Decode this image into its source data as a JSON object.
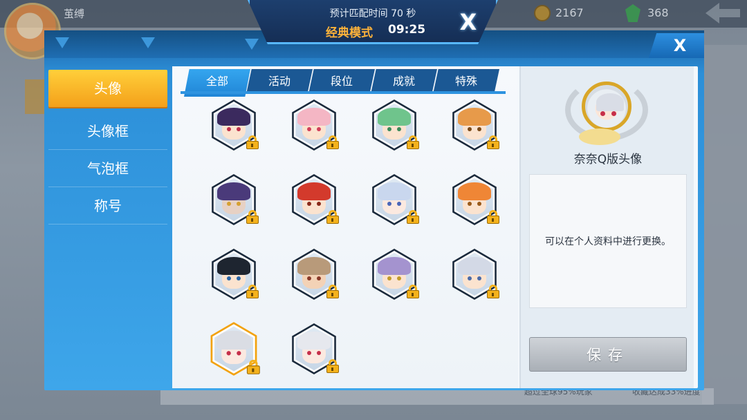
{
  "background": {
    "username": "茧缚",
    "coins": "2167",
    "gems": "368",
    "bottom_text_left": "超过全球95%玩家",
    "bottom_text_right": "收藏达成33%进度"
  },
  "match_banner": {
    "estimate_text": "预计匹配时间 70 秒",
    "mode": "经典模式",
    "clock": "09:25",
    "cancel_label": "X"
  },
  "dialog": {
    "close_label": "X",
    "sidenav": [
      {
        "label": "头像",
        "active": true
      },
      {
        "label": "头像框",
        "active": false
      },
      {
        "label": "气泡框",
        "active": false
      },
      {
        "label": "称号",
        "active": false
      }
    ],
    "tabs": [
      {
        "label": "全部",
        "active": true
      },
      {
        "label": "活动",
        "active": false
      },
      {
        "label": "段位",
        "active": false
      },
      {
        "label": "成就",
        "active": false
      },
      {
        "label": "特殊",
        "active": false
      }
    ],
    "avatars": [
      {
        "hair": "#3b2a5e",
        "skin": "#fbe3cf",
        "eye": "#c0304a",
        "locked": true,
        "selected": false
      },
      {
        "hair": "#f4b6c4",
        "skin": "#fbe3cf",
        "eye": "#d2405a",
        "locked": true,
        "selected": false
      },
      {
        "hair": "#6fc48c",
        "skin": "#fbe3cf",
        "eye": "#3a8a5a",
        "locked": true,
        "selected": false
      },
      {
        "hair": "#e79a4a",
        "skin": "#fbe3cf",
        "eye": "#7a4a1a",
        "locked": true,
        "selected": false
      },
      {
        "hair": "#4a3a7a",
        "skin": "#e7d1c4",
        "eye": "#d6a030",
        "locked": true,
        "selected": false
      },
      {
        "hair": "#d33a2c",
        "skin": "#fbe3cf",
        "eye": "#8a2a1a",
        "locked": true,
        "selected": false
      },
      {
        "hair": "#c9d7ee",
        "skin": "#fbe9e0",
        "eye": "#4a66b8",
        "locked": true,
        "selected": false
      },
      {
        "hair": "#ef8636",
        "skin": "#fbe3cf",
        "eye": "#9a5a1a",
        "locked": true,
        "selected": false
      },
      {
        "hair": "#1e2530",
        "skin": "#fbe3cf",
        "eye": "#2a66a8",
        "locked": true,
        "selected": false
      },
      {
        "hair": "#b89a7a",
        "skin": "#f3d2b6",
        "eye": "#8a3a2a",
        "locked": true,
        "selected": false
      },
      {
        "hair": "#a493cf",
        "skin": "#fbe3cf",
        "eye": "#c29a2a",
        "locked": true,
        "selected": false
      },
      {
        "hair": "#d3d9e6",
        "skin": "#fbe3cf",
        "eye": "#4a6aa8",
        "locked": true,
        "selected": false
      },
      {
        "hair": "#dadde4",
        "skin": "#fbe9e0",
        "eye": "#c62f4a",
        "locked": true,
        "selected": true
      },
      {
        "hair": "#e6e8ee",
        "skin": "#fbe9e0",
        "eye": "#c62f4a",
        "locked": true,
        "selected": false
      }
    ],
    "preview": {
      "name": "奈奈Q版头像",
      "description": "可以在个人资料中进行更换。"
    },
    "save_label": "保存"
  }
}
